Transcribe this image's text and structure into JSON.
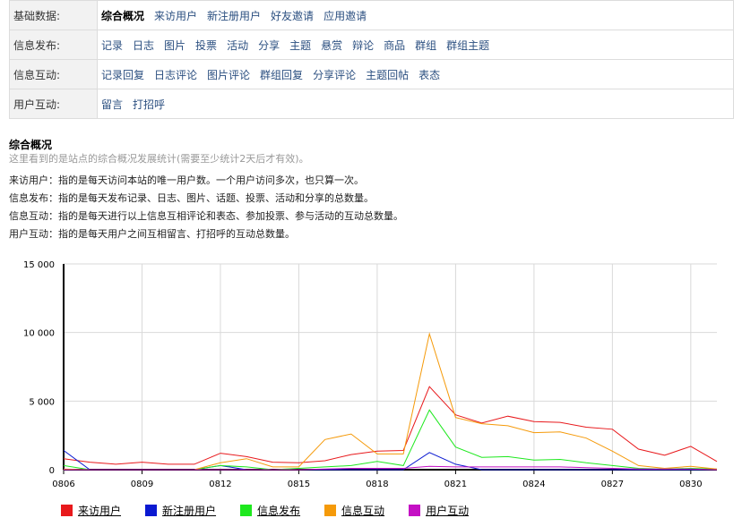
{
  "nav": {
    "rows": [
      {
        "header": "基础数据:",
        "items": [
          "综合概况",
          "来访用户",
          "新注册用户",
          "好友邀请",
          "应用邀请"
        ],
        "active": 0
      },
      {
        "header": "信息发布:",
        "items": [
          "记录",
          "日志",
          "图片",
          "投票",
          "活动",
          "分享",
          "主题",
          "悬赏",
          "辩论",
          "商品",
          "群组",
          "群组主题"
        ],
        "active": -1
      },
      {
        "header": "信息互动:",
        "items": [
          "记录回复",
          "日志评论",
          "图片评论",
          "群组回复",
          "分享评论",
          "主题回帖",
          "表态"
        ],
        "active": -1
      },
      {
        "header": "用户互动:",
        "items": [
          "留言",
          "打招呼"
        ],
        "active": -1
      }
    ]
  },
  "section": {
    "title": "综合概况",
    "subtitle": "这里看到的是站点的综合概况发展统计(需要至少统计2天后才有效)。",
    "definitions": [
      "来访用户：指的是每天访问本站的唯一用户数。一个用户访问多次，也只算一次。",
      "信息发布：指的是每天发布记录、日志、图片、话题、投票、活动和分享的总数量。",
      "信息互动：指的是每天进行以上信息互相评论和表态、参加投票、参与活动的互动总数量。",
      "用户互动：指的是每天用户之间互相留言、打招呼的互动总数量。"
    ]
  },
  "chart_data": {
    "type": "line",
    "x": [
      "0806",
      "0807",
      "0808",
      "0809",
      "0810",
      "0811",
      "0812",
      "0813",
      "0814",
      "0815",
      "0816",
      "0817",
      "0818",
      "0819",
      "0820",
      "0821",
      "0822",
      "0823",
      "0824",
      "0825",
      "0826",
      "0827",
      "0828",
      "0829",
      "0830",
      "0831"
    ],
    "x_tick_labels": [
      "0806",
      "0809",
      "0812",
      "0815",
      "0818",
      "0821",
      "0824",
      "0827",
      "0830"
    ],
    "y_tick_labels": [
      "0",
      "5 000",
      "10 000",
      "15 000"
    ],
    "ylim": [
      0,
      15000
    ],
    "grid": true,
    "legend_position": "bottom-left",
    "series": [
      {
        "name": "来访用户",
        "color": "#e8191c",
        "values": [
          800,
          550,
          400,
          550,
          400,
          400,
          1200,
          950,
          550,
          500,
          650,
          1100,
          1350,
          1400,
          6050,
          4000,
          3400,
          3900,
          3500,
          3450,
          3100,
          2950,
          1500,
          1050,
          1700,
          600
        ]
      },
      {
        "name": "新注册用户",
        "color": "#0a19d1",
        "values": [
          1400,
          0,
          0,
          0,
          0,
          0,
          300,
          0,
          0,
          0,
          0,
          0,
          0,
          0,
          1250,
          400,
          0,
          0,
          0,
          0,
          0,
          0,
          0,
          0,
          0,
          0
        ]
      },
      {
        "name": "信息发布",
        "color": "#1ee81e",
        "values": [
          300,
          0,
          0,
          0,
          0,
          0,
          300,
          200,
          0,
          100,
          200,
          300,
          600,
          300,
          4350,
          1650,
          900,
          950,
          700,
          750,
          500,
          300,
          100,
          50,
          100,
          50
        ]
      },
      {
        "name": "信息互动",
        "color": "#f59a0a",
        "values": [
          50,
          0,
          0,
          0,
          0,
          0,
          500,
          800,
          200,
          200,
          2200,
          2600,
          1150,
          1150,
          9900,
          3800,
          3350,
          3200,
          2700,
          2750,
          2300,
          1350,
          300,
          100,
          250,
          50
        ]
      },
      {
        "name": "用户互动",
        "color": "#c410c4",
        "values": [
          0,
          0,
          0,
          0,
          0,
          0,
          0,
          0,
          0,
          0,
          50,
          100,
          100,
          100,
          250,
          200,
          200,
          200,
          200,
          200,
          150,
          100,
          50,
          50,
          50,
          0
        ]
      }
    ]
  }
}
